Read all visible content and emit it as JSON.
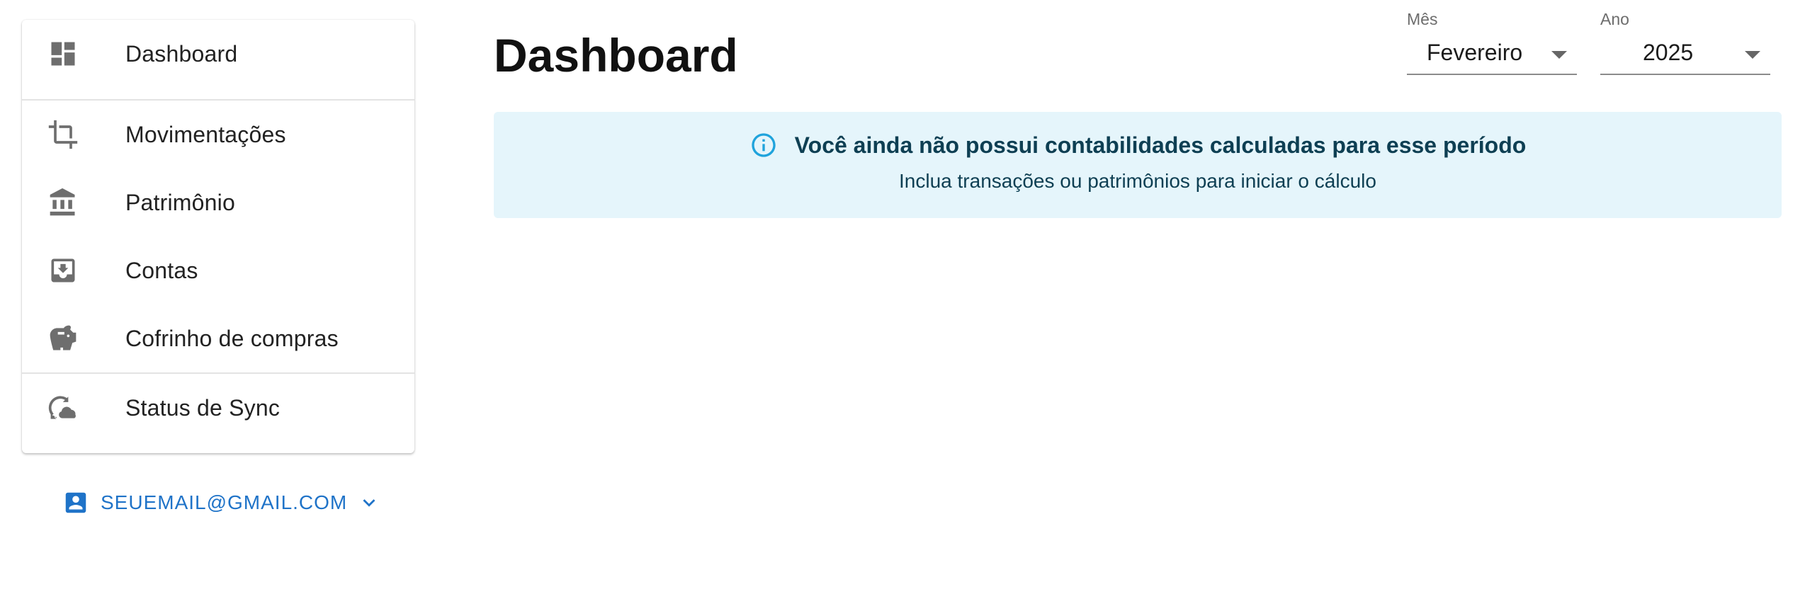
{
  "sidebar": {
    "items": [
      {
        "label": "Dashboard",
        "icon": "dashboard-icon"
      },
      {
        "label": "Movimentações",
        "icon": "crop-icon"
      },
      {
        "label": "Patrimônio",
        "icon": "bank-icon"
      },
      {
        "label": "Contas",
        "icon": "inbox-tray-icon"
      },
      {
        "label": "Cofrinho de compras",
        "icon": "piggy-bank-icon"
      },
      {
        "label": "Status de Sync",
        "icon": "sync-cloud-icon"
      }
    ]
  },
  "account": {
    "email": "SEUEMAIL@GMAIL.COM",
    "icon": "account-box-icon"
  },
  "header": {
    "title": "Dashboard",
    "month_select": {
      "label": "Mês",
      "value": "Fevereiro"
    },
    "year_select": {
      "label": "Ano",
      "value": "2025"
    }
  },
  "alert": {
    "icon": "info-icon",
    "title": "Você ainda não possui contabilidades calculadas para esse período",
    "message": "Inclua transações ou patrimônios para iniciar o cálculo"
  },
  "colors": {
    "accent": "#1f73c8",
    "alert_bg": "#e5f5fb",
    "alert_text": "#0e3f53",
    "info_icon": "#1fa3dc",
    "nav_icon": "#6e6e6e"
  }
}
